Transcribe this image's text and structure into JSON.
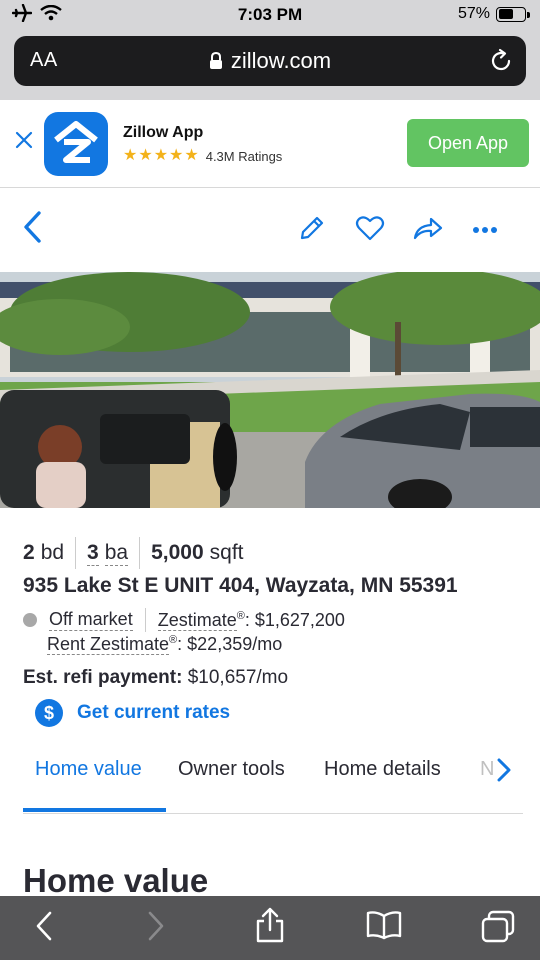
{
  "status_bar": {
    "time": "7:03 PM",
    "battery": "57%",
    "battery_level": 0.57
  },
  "safari": {
    "text_size_label": "AA",
    "url": "zillow.com"
  },
  "app_banner": {
    "name": "Zillow App",
    "ratings": "4.3M Ratings",
    "stars": 5,
    "cta": "Open App"
  },
  "listing": {
    "beds_value": "2",
    "beds_unit": "bd",
    "baths_value": "3",
    "baths_unit": "ba",
    "sqft_value": "5,000",
    "sqft_unit": "sqft",
    "address": "935 Lake St E UNIT 404, Wayzata, MN 55391",
    "status": "Off market",
    "zestimate_label": "Zestimate",
    "zestimate_value": ": $1,627,200",
    "rent_label": "Rent Zestimate",
    "rent_value": ": $22,359/mo",
    "reg_mark": "®",
    "refi_label": "Est. refi payment:",
    "refi_value": "$10,657/mo",
    "rates_link": "Get current rates",
    "dollar_symbol": "$"
  },
  "tabs": [
    {
      "label": "Home value",
      "active": true
    },
    {
      "label": "Owner tools",
      "active": false
    },
    {
      "label": "Home details",
      "active": false
    },
    {
      "label": "N",
      "active": false
    }
  ],
  "section_title": "Home value",
  "colors": {
    "accent": "#1277e1",
    "open_app": "#62c462",
    "star": "#f3b21a",
    "chrome_bg": "#d6d6d8",
    "bottom_bar": "#555557"
  }
}
